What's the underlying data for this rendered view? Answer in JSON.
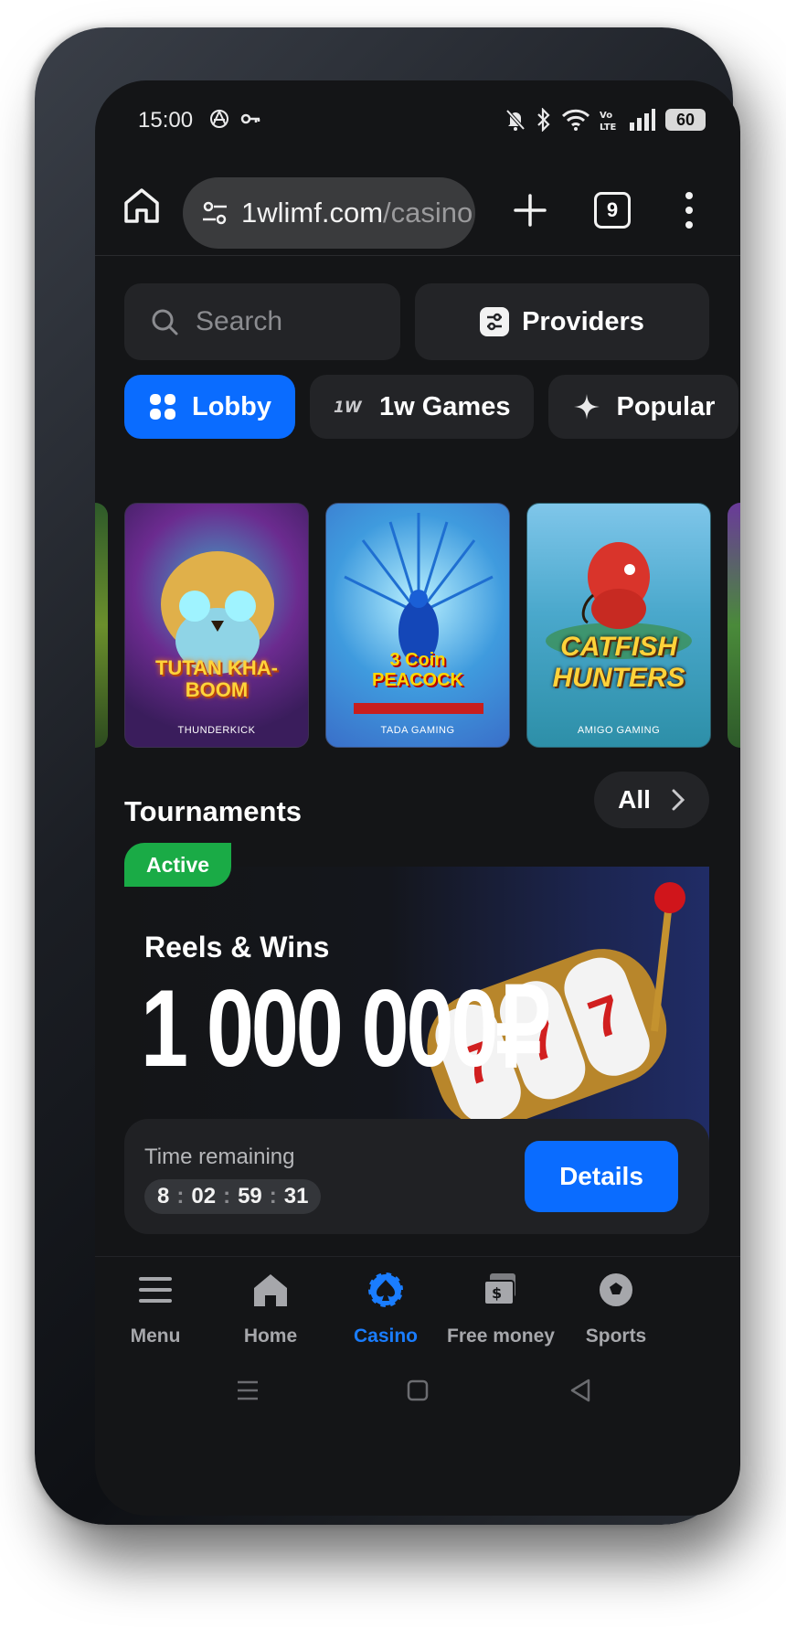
{
  "status": {
    "time": "15:00",
    "battery": "60"
  },
  "browser": {
    "url_main": "1wlimf.com",
    "url_path": "/casino",
    "tab_count": "9"
  },
  "search": {
    "placeholder": "Search"
  },
  "providers_label": "Providers",
  "categories": [
    {
      "label": "Lobby",
      "active": true
    },
    {
      "label": "1w Games",
      "active": false
    },
    {
      "label": "Popular",
      "active": false
    }
  ],
  "games": [
    {
      "title": "TUTAN KHA-BOOM",
      "provider": "THUNDERKICK"
    },
    {
      "title": "3 Coin PEACOCK",
      "provider": "TADA GAMING"
    },
    {
      "title": "CATFISH HUNTERS",
      "provider": "AMIGO GAMING"
    }
  ],
  "tournaments": {
    "title": "Tournaments",
    "all_label": "All",
    "badge": "Active",
    "name": "Reels & Wins",
    "prize": "1 000 000₽",
    "time_label": "Time remaining",
    "timer": {
      "days": "8",
      "hours": "02",
      "minutes": "59",
      "seconds": "31"
    },
    "details_label": "Details"
  },
  "bottom_nav": [
    {
      "label": "Menu",
      "icon": "menu-icon"
    },
    {
      "label": "Home",
      "icon": "home-icon"
    },
    {
      "label": "Casino",
      "icon": "casino-icon",
      "active": true
    },
    {
      "label": "Free money",
      "icon": "money-icon"
    },
    {
      "label": "Sports",
      "icon": "soccer-ball-icon"
    }
  ],
  "colors": {
    "accent": "#0a6cff",
    "active_badge": "#1aab46",
    "background": "#141517"
  }
}
